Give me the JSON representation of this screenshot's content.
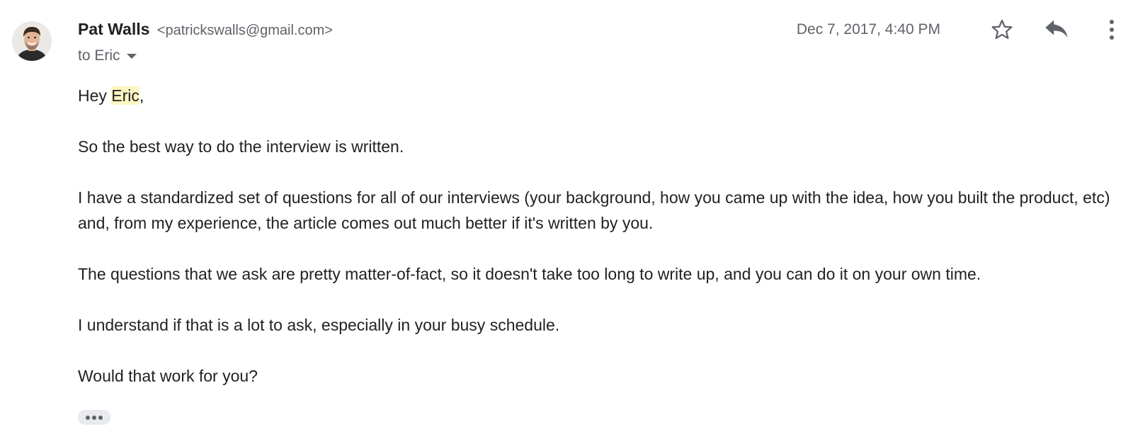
{
  "sender": {
    "name": "Pat Walls",
    "email": "<patrickswalls@gmail.com>",
    "avatar_icon": "person-photo"
  },
  "recipient": {
    "label": "to Eric"
  },
  "date": "Dec 7, 2017, 4:40 PM",
  "actions": {
    "star_icon": "star-outline-icon",
    "reply_icon": "reply-icon",
    "more_icon": "more-vertical-icon"
  },
  "message": {
    "greeting_prefix": "Hey ",
    "greeting_name": "Eric",
    "greeting_suffix": ",",
    "paragraphs": [
      "So the best way to do the interview is written.",
      "I have a standardized set of questions for all of our interviews (your background, how you came up with the idea, how you built the product, etc) and, from my experience, the article comes out much better if it's written by you.",
      "The questions that we ask are pretty matter-of-fact, so it doesn't take too long to write up, and you can do it on your own time.",
      "I understand if that is a lot to ask, especially in your busy schedule.",
      "Would that work for you?"
    ]
  },
  "trimmed_content_icon": "ellipsis-icon",
  "colors": {
    "highlight": "#fdf6c3",
    "secondary_text": "#5f6368",
    "icon": "#5f6368"
  }
}
